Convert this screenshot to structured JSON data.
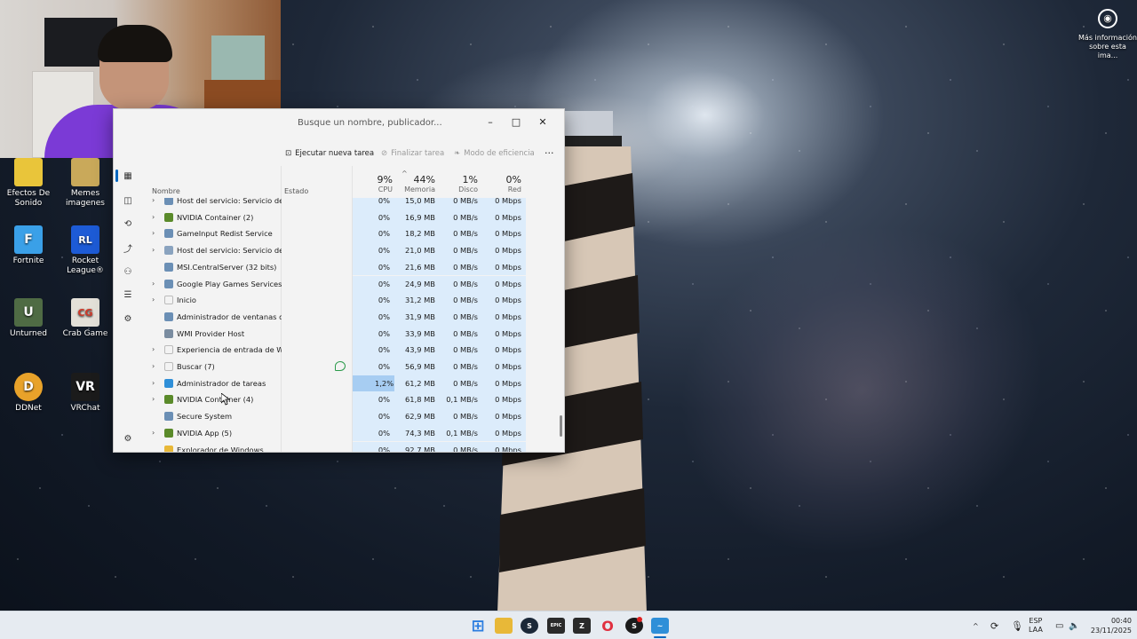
{
  "desktop": {
    "corner_info": "Más información sobre esta ima...",
    "icons": [
      {
        "label": "Efectos De Sonido",
        "color": "#e9c53a",
        "glyph": ""
      },
      {
        "label": "Memes imagenes",
        "color": "#c9a95a",
        "glyph": ""
      },
      {
        "label": "Fortnite",
        "color": "#3aa0e8",
        "glyph": "F"
      },
      {
        "label": "Rocket League®",
        "color": "#1d5bd6",
        "glyph": "RL"
      },
      {
        "label": "Unturned",
        "color": "#4f6b44",
        "glyph": "U"
      },
      {
        "label": "Crab Game",
        "color": "#e3e0d8",
        "glyph": "CG"
      },
      {
        "label": "DDNet",
        "color": "#e8a22a",
        "glyph": "D"
      },
      {
        "label": "VRChat",
        "color": "#1b1b1b",
        "glyph": "VR"
      }
    ]
  },
  "task_manager": {
    "search_placeholder": "Busque un nombre, publicador...",
    "toolbar": {
      "run_new_task": "Ejecutar nueva tarea",
      "end_task": "Finalizar tarea",
      "efficiency_mode": "Modo de eficiencia",
      "more": "···"
    },
    "columns": {
      "name": "Nombre",
      "status": "Estado",
      "cpu_pct": "9%",
      "cpu": "CPU",
      "mem_pct": "44%",
      "mem": "Memoria",
      "disk_pct": "1%",
      "disk": "Disco",
      "net_pct": "0%",
      "net": "Red"
    },
    "rows": [
      {
        "name": "Host del servicio: Servicio de r...",
        "expand": true,
        "cpu": "0%",
        "mem": "15,0 MB",
        "disk": "0 MB/s",
        "net": "0 Mbps",
        "icon": "#6b8fb5"
      },
      {
        "name": "NVIDIA Container (2)",
        "expand": true,
        "cpu": "0%",
        "mem": "16,9 MB",
        "disk": "0 MB/s",
        "net": "0 Mbps",
        "icon": "#5a8a2a"
      },
      {
        "name": "GameInput Redist Service",
        "expand": true,
        "cpu": "0%",
        "mem": "18,2 MB",
        "disk": "0 MB/s",
        "net": "0 Mbps",
        "icon": "#6b8fb5"
      },
      {
        "name": "Host del servicio: Servicio de d...",
        "expand": true,
        "cpu": "0%",
        "mem": "21,0 MB",
        "disk": "0 MB/s",
        "net": "0 Mbps",
        "icon": "#8aa3bf"
      },
      {
        "name": "MSI.CentralServer (32 bits)",
        "expand": false,
        "cpu": "0%",
        "mem": "21,6 MB",
        "disk": "0 MB/s",
        "net": "0 Mbps",
        "icon": "#6b8fb5"
      },
      {
        "name": "Google Play Games Services",
        "expand": true,
        "cpu": "0%",
        "mem": "24,9 MB",
        "disk": "0 MB/s",
        "net": "0 Mbps",
        "icon": "#6b8fb5"
      },
      {
        "name": "Inicio",
        "expand": true,
        "cpu": "0%",
        "mem": "31,2 MB",
        "disk": "0 MB/s",
        "net": "0 Mbps",
        "icon": ""
      },
      {
        "name": "Administrador de ventanas de...",
        "expand": false,
        "cpu": "0%",
        "mem": "31,9 MB",
        "disk": "0 MB/s",
        "net": "0 Mbps",
        "icon": "#6b8fb5"
      },
      {
        "name": "WMI Provider Host",
        "expand": false,
        "cpu": "0%",
        "mem": "33,9 MB",
        "disk": "0 MB/s",
        "net": "0 Mbps",
        "icon": "#7a8ca0"
      },
      {
        "name": "Experiencia de entrada de Win...",
        "expand": true,
        "cpu": "0%",
        "mem": "43,9 MB",
        "disk": "0 MB/s",
        "net": "0 Mbps",
        "icon": ""
      },
      {
        "name": "Buscar (7)",
        "expand": true,
        "cpu": "0%",
        "mem": "56,9 MB",
        "disk": "0 MB/s",
        "net": "0 Mbps",
        "icon": "",
        "efficiency": true
      },
      {
        "name": "Administrador de tareas",
        "expand": true,
        "cpu": "1,2%",
        "mem": "61,2 MB",
        "disk": "0 MB/s",
        "net": "0 Mbps",
        "icon": "#2f8fd8",
        "cpu_hi": true
      },
      {
        "name": "NVIDIA Container (4)",
        "expand": true,
        "cpu": "0%",
        "mem": "61,8 MB",
        "disk": "0,1 MB/s",
        "net": "0 Mbps",
        "icon": "#5a8a2a"
      },
      {
        "name": "Secure System",
        "expand": false,
        "cpu": "0%",
        "mem": "62,9 MB",
        "disk": "0 MB/s",
        "net": "0 Mbps",
        "icon": "#6b8fb5"
      },
      {
        "name": "NVIDIA App (5)",
        "expand": true,
        "cpu": "0%",
        "mem": "74,3 MB",
        "disk": "0,1 MB/s",
        "net": "0 Mbps",
        "icon": "#5a8a2a"
      },
      {
        "name": "Explorador de Windows",
        "expand": false,
        "cpu": "0%",
        "mem": "92,7 MB",
        "disk": "0 MB/s",
        "net": "0 Mbps",
        "icon": "#e8b838"
      }
    ]
  },
  "taskbar": {
    "apps": [
      {
        "name": "start",
        "color": "#2b7de0",
        "glyph": "⊞"
      },
      {
        "name": "file-explorer",
        "color": "#e8b838",
        "glyph": ""
      },
      {
        "name": "steam",
        "color": "#1b2838",
        "glyph": "S"
      },
      {
        "name": "epic-games",
        "color": "#2a2a2a",
        "glyph": "EPIC"
      },
      {
        "name": "app-z",
        "color": "#2a2a2a",
        "glyph": "Z"
      },
      {
        "name": "opera",
        "color": "#e03040",
        "glyph": "O"
      },
      {
        "name": "app-dark",
        "color": "#1a1a1a",
        "glyph": "S"
      },
      {
        "name": "task-manager",
        "color": "#2f8fd8",
        "glyph": "~"
      }
    ],
    "lang_top": "ESP",
    "lang_bottom": "LAA",
    "time": "00:40",
    "date": "23/11/2025"
  }
}
